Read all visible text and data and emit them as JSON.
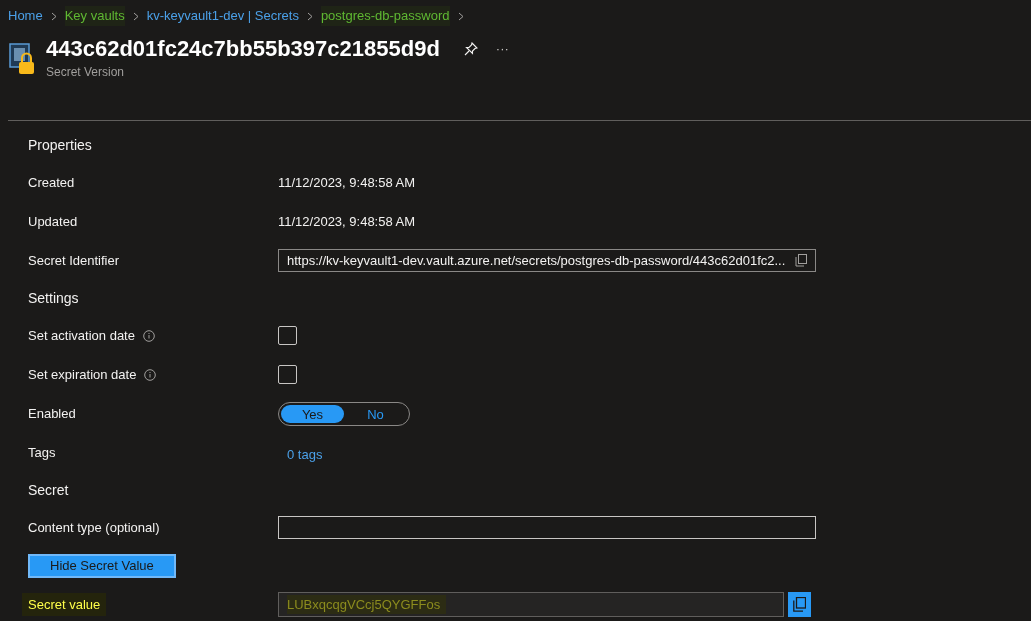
{
  "breadcrumbs": [
    {
      "label": "Home",
      "highlighted": false
    },
    {
      "label": "Key vaults",
      "highlighted": true
    },
    {
      "label": "kv-keyvault1-dev | Secrets",
      "highlighted": false
    },
    {
      "label": "postgres-db-password",
      "highlighted": true
    }
  ],
  "header": {
    "title": "443c62d01fc24c7bb55b397c21855d9d",
    "subtitle": "Secret Version",
    "more": "···"
  },
  "rows": [
    {
      "kind": "heading",
      "label": "Properties"
    },
    {
      "kind": "text",
      "label": "Created",
      "value": "11/12/2023, 9:48:58 AM"
    },
    {
      "kind": "text",
      "label": "Updated",
      "value": "11/12/2023, 9:48:58 AM"
    },
    {
      "kind": "copyfield",
      "label": "Secret Identifier",
      "value": "https://kv-keyvault1-dev.vault.azure.net/secrets/postgres-db-password/443c62d01fc2..."
    },
    {
      "kind": "heading",
      "label": "Settings"
    },
    {
      "kind": "checkbox",
      "label": "Set activation date",
      "info": true,
      "checked": false
    },
    {
      "kind": "checkbox",
      "label": "Set expiration date",
      "info": true,
      "checked": false
    },
    {
      "kind": "toggle",
      "label": "Enabled",
      "options": [
        {
          "label": "Yes",
          "selected": true
        },
        {
          "label": "No",
          "selected": false
        }
      ]
    },
    {
      "kind": "link",
      "label": "Tags",
      "value": "0 tags"
    },
    {
      "kind": "heading",
      "label": "Secret"
    },
    {
      "kind": "input",
      "label": "Content type (optional)"
    },
    {
      "kind": "button",
      "label": "Hide Secret Value"
    },
    {
      "kind": "secret",
      "label": "Secret value",
      "highlighted": true,
      "value": "LUBxqcqgVCcj5QYGFFos",
      "value_highlighted": true
    }
  ]
}
